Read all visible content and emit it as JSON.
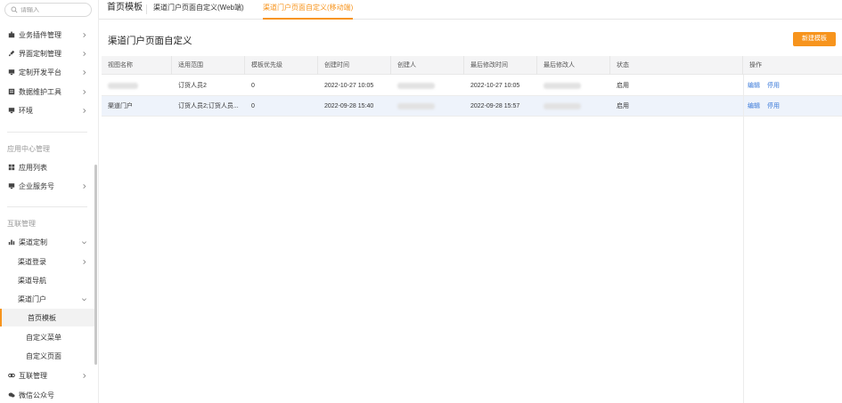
{
  "sidebar": {
    "search_placeholder": "请输入",
    "items": [
      {
        "label": "业务插件管理",
        "icon": "puzzle-icon"
      },
      {
        "label": "界面定制管理",
        "icon": "brush-icon"
      },
      {
        "label": "定制开发平台",
        "icon": "monitor-icon"
      },
      {
        "label": "数据维护工具",
        "icon": "database-icon"
      },
      {
        "label": "环境",
        "icon": "monitor-icon"
      }
    ],
    "section_app": "应用中心管理",
    "app_items": [
      {
        "label": "应用列表",
        "icon": "grid-icon"
      },
      {
        "label": "企业服务号",
        "icon": "monitor-icon"
      }
    ],
    "section_interconnect": "互联管理",
    "channel_custom": "渠道定制",
    "channel_login": "渠道登录",
    "channel_nav": "渠道导航",
    "channel_portal": "渠道门户",
    "portal_children": [
      "首页模板",
      "自定义菜单",
      "自定义页面"
    ],
    "interconnect_mgmt": "互联管理",
    "wechat_official": "微信公众号"
  },
  "tabs": [
    "首页模板",
    "渠道门户页面自定义(Web端)",
    "渠道门户页面自定义(移动端)"
  ],
  "page": {
    "title": "渠道门户页面自定义",
    "new_button": "新建模板"
  },
  "table": {
    "columns": [
      "视图名称",
      "适用范围",
      "模板优先级",
      "创建时间",
      "创建人",
      "最后修改时间",
      "最后修改人",
      "状态",
      "操作"
    ],
    "rows": [
      {
        "name": "",
        "scope": "订货人员2",
        "priority": "0",
        "created": "2022-10-27 10:05",
        "creator": "",
        "modified": "2022-10-27 10:05",
        "modifier": "",
        "status": "启用",
        "actions": [
          "编辑",
          "停用"
        ]
      },
      {
        "name": "渠道门户",
        "scope": "订货人员2;订货人员...",
        "priority": "0",
        "created": "2022-09-28 15:40",
        "creator": "",
        "modified": "2022-09-28 15:57",
        "modifier": "",
        "status": "启用",
        "actions": [
          "编辑",
          "停用"
        ]
      }
    ]
  },
  "colors": {
    "accent": "#f7941d",
    "link": "#3b7ad9"
  }
}
